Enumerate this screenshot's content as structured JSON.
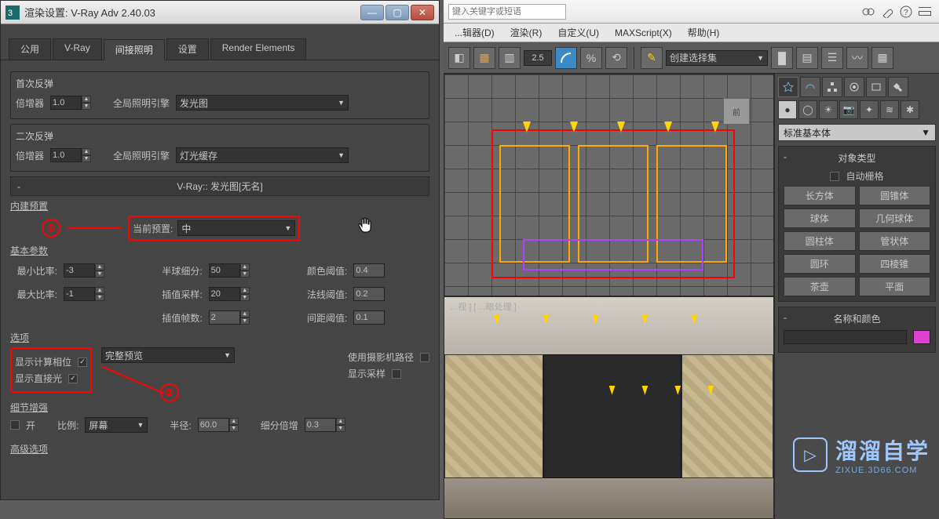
{
  "dialog": {
    "title": "渲染设置: V-Ray Adv 2.40.03",
    "tabs": [
      "公用",
      "V-Ray",
      "间接照明",
      "设置",
      "Render Elements"
    ],
    "active_tab": 2,
    "bounce1": {
      "title": "首次反弹",
      "multiplier_label": "倍增器",
      "multiplier": "1.0",
      "gi_label": "全局照明引擎",
      "gi_engine": "发光图"
    },
    "bounce2": {
      "title": "二次反弹",
      "multiplier_label": "倍增器",
      "multiplier": "1.0",
      "gi_label": "全局照明引擎",
      "gi_engine": "灯光缓存"
    },
    "irradiance": {
      "header": "V-Ray:: 发光图[无名]",
      "preset_group": "内建预置",
      "preset_label": "当前预置:",
      "preset_value": "中",
      "annotation1": "①"
    },
    "basic": {
      "title": "基本参数",
      "min_rate_label": "最小比率:",
      "min_rate": "-3",
      "max_rate_label": "最大比率:",
      "max_rate": "-1",
      "hsph_label": "半球细分:",
      "hsph": "50",
      "interp_label": "插值采样:",
      "interp": "20",
      "frames_label": "插值帧数:",
      "frames": "2",
      "clr_label": "颜色阈值:",
      "clr": "0.4",
      "nrm_label": "法线阈值:",
      "nrm": "0.2",
      "dist_label": "间距阈值:",
      "dist": "0.1"
    },
    "options": {
      "title": "选项",
      "show_calc": "显示计算相位",
      "show_direct": "显示直接光",
      "mode_value": "完整预览",
      "use_camera": "使用摄影机路径",
      "show_samples": "显示采样",
      "annotation2": "②"
    },
    "detail": {
      "title": "细节增强",
      "on": "开",
      "scale_label": "比例:",
      "scale_value": "屏幕",
      "radius_label": "半径:",
      "radius": "60.0",
      "subdiv_label": "细分倍增",
      "subdiv": "0.3"
    },
    "advanced": {
      "title": "高级选项"
    }
  },
  "main": {
    "search_placeholder": "键入关键字或短语",
    "menu": [
      "...辑器(D)",
      "渲染(R)",
      "自定义(U)",
      "MAXScript(X)",
      "帮助(H)"
    ],
    "angle": "2.5",
    "selset": "创建选择集",
    "viewport_persp_label": "...视 ] [ ...暗处理 ]",
    "cmd": {
      "dd": "标准基本体",
      "obj_type": "对象类型",
      "autogrid": "自动栅格",
      "prims": [
        "长方体",
        "圆锥体",
        "球体",
        "几何球体",
        "圆柱体",
        "管状体",
        "圆环",
        "四棱锥",
        "茶壶",
        "平面"
      ],
      "name_color": "名称和颜色"
    }
  },
  "watermark": {
    "t1": "溜溜自学",
    "t2": "ZIXUE.3D66.COM"
  }
}
